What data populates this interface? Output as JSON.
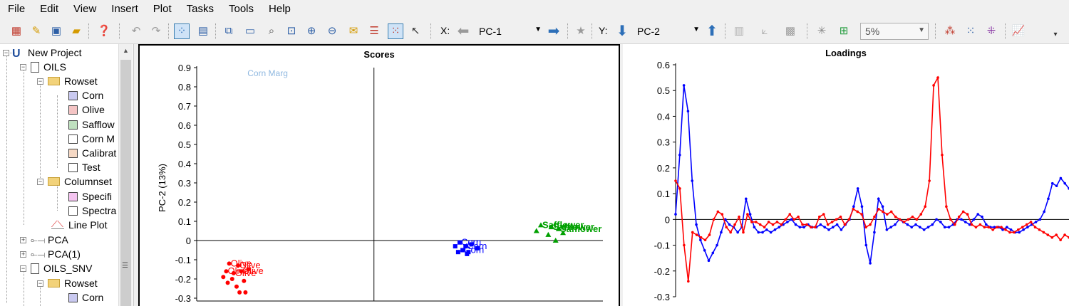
{
  "menu": [
    "File",
    "Edit",
    "View",
    "Insert",
    "Plot",
    "Tasks",
    "Tools",
    "Help"
  ],
  "toolbar": {
    "x_label": "X:",
    "x_value": "PC-1",
    "y_label": "Y:",
    "y_value": "PC-2",
    "percent_value": "5%",
    "icons": [
      "new-plot-icon",
      "edit-icon",
      "save-icon",
      "open-icon",
      "help-icon",
      "undo-icon",
      "redo-icon",
      "scatter-view-icon",
      "table-view-icon",
      "copy-icon",
      "window-icon",
      "identify-icon",
      "zoom-box-icon",
      "zoom-in-icon",
      "zoom-out-icon",
      "note-icon",
      "legend-icon",
      "select-box-icon",
      "pointer-icon",
      "arrow-left-icon",
      "arrow-right-icon",
      "star-icon",
      "arrow-down-icon",
      "arrow-up-icon",
      "bars-icon",
      "axes-icon",
      "fill-icon",
      "crosshair-icon",
      "ellipse-icon",
      "cluster-icon",
      "group-icon",
      "scatter-icon",
      "line-chart-icon"
    ]
  },
  "tree": {
    "project": "New Project",
    "items": [
      {
        "label": "OILS",
        "kind": "doc"
      },
      {
        "label": "Rowset",
        "kind": "folder"
      },
      {
        "label": "Corn",
        "kind": "swatch",
        "color": "#c9c9f0"
      },
      {
        "label": "Olive",
        "kind": "swatch",
        "color": "#f4c4c4"
      },
      {
        "label": "Safflow",
        "kind": "swatch",
        "color": "#bfe0bf"
      },
      {
        "label": "Corn M",
        "kind": "swatch",
        "color": "#ffffff"
      },
      {
        "label": "Calibrat",
        "kind": "swatch",
        "color": "#f5d8c4"
      },
      {
        "label": "Test",
        "kind": "swatch",
        "color": "#ffffff"
      },
      {
        "label": "Columnset",
        "kind": "folder"
      },
      {
        "label": "Specifi",
        "kind": "swatch",
        "color": "#f4c4f0"
      },
      {
        "label": "Spectra",
        "kind": "swatch",
        "color": "#ffffff"
      },
      {
        "label": "Line Plot",
        "kind": "plot"
      },
      {
        "label": "PCA",
        "kind": "model"
      },
      {
        "label": "PCA(1)",
        "kind": "model"
      },
      {
        "label": "OILS_SNV",
        "kind": "doc"
      },
      {
        "label": "Rowset",
        "kind": "folder"
      },
      {
        "label": "Corn",
        "kind": "swatch",
        "color": "#c9c9f0"
      }
    ]
  },
  "scores": {
    "title": "Scores",
    "ylabel": "PC-2 (13%)"
  },
  "loadings": {
    "title": "Loadings"
  },
  "chart_data": [
    {
      "type": "scatter",
      "title": "Scores",
      "xlabel": "",
      "ylabel": "PC-2 (13%)",
      "xlim": [
        -1.2,
        1.55
      ],
      "ylim": [
        -0.3,
        0.9
      ],
      "y_ticks": [
        0.9,
        0.8,
        0.7,
        0.6,
        0.5,
        0.4,
        0.3,
        0.2,
        0.1,
        0,
        -0.1,
        -0.2,
        -0.3
      ],
      "x_ticks": [],
      "series": [
        {
          "name": "Olive",
          "color": "#ff0000",
          "marker": "circle",
          "points": [
            [
              -0.98,
              -0.12
            ],
            [
              -0.92,
              -0.13
            ],
            [
              -1.0,
              -0.16
            ],
            [
              -0.95,
              -0.17
            ],
            [
              -0.9,
              -0.16
            ],
            [
              -0.96,
              -0.2
            ],
            [
              -0.88,
              -0.21
            ],
            [
              -0.99,
              -0.22
            ],
            [
              -0.93,
              -0.24
            ],
            [
              -0.91,
              -0.27
            ],
            [
              -0.87,
              -0.27
            ],
            [
              -1.02,
              -0.19
            ],
            [
              -0.85,
              -0.15
            ]
          ],
          "labels": [
            "Olive",
            "Olive",
            "Olive",
            "Olive",
            "Olive"
          ]
        },
        {
          "name": "Corn",
          "color": "#0000ff",
          "marker": "square",
          "points": [
            [
              0.58,
              -0.01
            ],
            [
              0.62,
              -0.03
            ],
            [
              0.6,
              -0.05
            ],
            [
              0.64,
              -0.06
            ],
            [
              0.57,
              -0.06
            ],
            [
              0.66,
              -0.02
            ],
            [
              0.7,
              -0.04
            ],
            [
              0.55,
              -0.03
            ],
            [
              0.63,
              -0.07
            ]
          ],
          "labels": [
            "Corn",
            "Corn",
            "Corn"
          ]
        },
        {
          "name": "Safflower",
          "color": "#00a000",
          "marker": "triangle",
          "points": [
            [
              1.13,
              0.08
            ],
            [
              1.2,
              0.07
            ],
            [
              1.25,
              0.06
            ],
            [
              1.18,
              0.03
            ],
            [
              1.28,
              0.04
            ],
            [
              1.1,
              0.05
            ],
            [
              1.23,
              0.0
            ]
          ],
          "labels": [
            "Safflower",
            "Safflower",
            "Safflower"
          ]
        },
        {
          "name": "Corn Marg",
          "color": "#8fb8e0",
          "marker": "none",
          "points": [
            [
              -0.76,
              0.87
            ]
          ],
          "labels": [
            "Corn Marg"
          ]
        }
      ]
    },
    {
      "type": "line",
      "title": "Loadings",
      "ylim": [
        -0.3,
        0.6
      ],
      "y_ticks": [
        0.6,
        0.5,
        0.4,
        0.3,
        0.2,
        0.1,
        0,
        -0.1,
        -0.2,
        -0.3
      ],
      "series": [
        {
          "name": "",
          "color": "#0000ff",
          "values": [
            0.02,
            0.25,
            0.52,
            0.42,
            0.15,
            -0.02,
            -0.08,
            -0.12,
            -0.16,
            -0.13,
            -0.1,
            -0.05,
            0.0,
            -0.02,
            -0.03,
            -0.05,
            -0.03,
            0.08,
            0.02,
            -0.03,
            -0.05,
            -0.05,
            -0.04,
            -0.05,
            -0.04,
            -0.03,
            -0.02,
            -0.01,
            0.0,
            -0.02,
            -0.03,
            -0.03,
            -0.02,
            -0.03,
            -0.03,
            -0.02,
            -0.03,
            -0.04,
            -0.03,
            -0.02,
            -0.04,
            -0.02,
            0.0,
            0.05,
            0.12,
            0.05,
            -0.1,
            -0.17,
            -0.05,
            0.08,
            0.05,
            -0.04,
            -0.03,
            -0.02,
            0.0,
            -0.01,
            -0.02,
            -0.03,
            -0.02,
            -0.03,
            -0.04,
            -0.03,
            -0.02,
            0.0,
            -0.01,
            -0.03,
            -0.03,
            -0.02,
            0.0,
            0.0,
            -0.01,
            -0.02,
            0.0,
            0.02,
            0.01,
            -0.02,
            -0.03,
            -0.03,
            -0.03,
            -0.04,
            -0.03,
            -0.04,
            -0.05,
            -0.05,
            -0.04,
            -0.03,
            -0.02,
            -0.01,
            0.0,
            0.03,
            0.08,
            0.14,
            0.13,
            0.16,
            0.14,
            0.12
          ]
        },
        {
          "name": "",
          "color": "#ff0000",
          "values": [
            0.15,
            0.12,
            -0.1,
            -0.24,
            -0.05,
            -0.06,
            -0.07,
            -0.08,
            -0.06,
            0.0,
            0.03,
            0.02,
            -0.03,
            -0.05,
            -0.02,
            0.01,
            -0.05,
            0.02,
            -0.01,
            -0.01,
            -0.02,
            -0.03,
            -0.01,
            -0.02,
            -0.01,
            -0.02,
            0.0,
            0.02,
            0.0,
            0.01,
            -0.02,
            -0.02,
            -0.03,
            -0.03,
            0.01,
            0.02,
            -0.02,
            -0.01,
            0.0,
            0.01,
            -0.02,
            0.0,
            0.04,
            0.03,
            0.02,
            -0.03,
            -0.02,
            0.01,
            0.04,
            0.03,
            0.02,
            0.03,
            0.01,
            0.0,
            -0.01,
            0.0,
            0.01,
            0.0,
            0.02,
            0.05,
            0.15,
            0.52,
            0.55,
            0.25,
            0.05,
            0.0,
            -0.02,
            0.01,
            0.03,
            0.02,
            -0.02,
            -0.03,
            -0.02,
            -0.03,
            -0.03,
            -0.04,
            -0.03,
            -0.03,
            -0.04,
            -0.05,
            -0.05,
            -0.04,
            -0.03,
            -0.02,
            -0.01,
            -0.03,
            -0.04,
            -0.05,
            -0.06,
            -0.07,
            -0.06,
            -0.08,
            -0.06,
            -0.07
          ]
        }
      ]
    }
  ]
}
